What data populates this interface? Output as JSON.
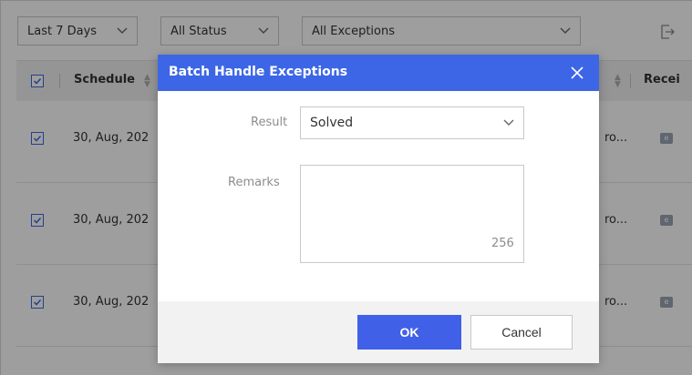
{
  "filters": {
    "time_range": "Last 7 Days",
    "status": "All Status",
    "exceptions": "All Exceptions"
  },
  "icons": {
    "export": "export-icon",
    "chevron": "chevron-down-icon",
    "checkbox": "checkbox-checked-icon",
    "sort": "sort-icon",
    "close": "close-icon",
    "device": "e-badge-icon"
  },
  "table": {
    "headers": {
      "schedule": "Schedule",
      "receiver": "Recei"
    },
    "rows": [
      {
        "schedule": "30, Aug, 202",
        "truncated": "ro...",
        "badge": "e"
      },
      {
        "schedule": "30, Aug, 202",
        "truncated": "ro...",
        "badge": "e"
      },
      {
        "schedule": "30, Aug, 202",
        "truncated": "ro...",
        "badge": "e"
      }
    ]
  },
  "modal": {
    "title": "Batch Handle Exceptions",
    "result_label": "Result",
    "result_value": "Solved",
    "remarks_label": "Remarks",
    "remarks_value": "",
    "remarks_counter": "256",
    "ok_label": "OK",
    "cancel_label": "Cancel"
  },
  "colors": {
    "accent": "#3d66e6",
    "ok_button": "#4060e8",
    "overlay": "rgba(0,0,0,0.38)"
  }
}
